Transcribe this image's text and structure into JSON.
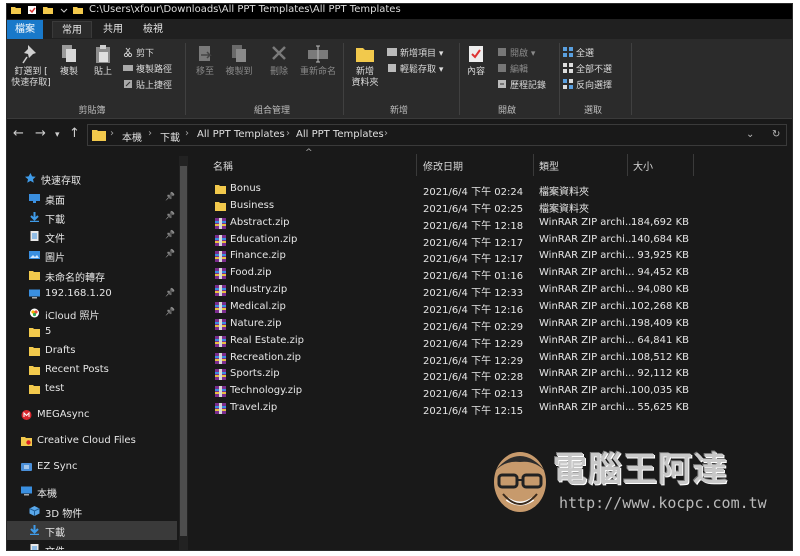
{
  "titlebar": {
    "path": "C:\\Users\\xfour\\Downloads\\All PPT Templates\\All PPT Templates"
  },
  "tabs": [
    {
      "label": "檔案"
    },
    {
      "label": "常用"
    },
    {
      "label": "共用"
    },
    {
      "label": "檢視"
    }
  ],
  "ribbon": {
    "pin_label_1": "釘選到 [",
    "pin_label_2": "快速存取]",
    "copy": "複製",
    "paste": "貼上",
    "cut": "剪下",
    "copy_path": "複製路徑",
    "paste_shortcut": "貼上捷徑",
    "clipboard_group": "剪貼簿",
    "move_to": "移至",
    "copy_to": "複製到",
    "delete": "刪除",
    "rename": "重新命名",
    "organize_group": "組合管理",
    "new_item": "新增項目",
    "easy_access": "輕鬆存取",
    "new_folder_1": "新增",
    "new_folder_2": "資料夾",
    "new_group": "新增",
    "properties": "內容",
    "open": "開啟",
    "edit": "編輯",
    "history": "歷程記錄",
    "open_group": "開啟",
    "select_all": "全選",
    "select_none": "全部不選",
    "invert_selection": "反向選擇",
    "select_group": "選取"
  },
  "address": {
    "crumbs": [
      "本機",
      "下載",
      "All PPT Templates",
      "All PPT Templates"
    ]
  },
  "sidebar": {
    "items": [
      {
        "label": "快速存取",
        "icon": "star-icon"
      },
      {
        "label": "桌面",
        "icon": "desktop-icon"
      },
      {
        "label": "下載",
        "icon": "download-icon"
      },
      {
        "label": "文件",
        "icon": "document-icon"
      },
      {
        "label": "圖片",
        "icon": "picture-icon"
      },
      {
        "label": "未命名的轉存",
        "icon": "folder-icon"
      },
      {
        "label": "192.168.1.20",
        "icon": "monitor-icon"
      },
      {
        "label": "iCloud 照片",
        "icon": "icloud-photos-icon"
      },
      {
        "label": "5",
        "icon": "folder-icon"
      },
      {
        "label": "Drafts",
        "icon": "folder-icon"
      },
      {
        "label": "Recent Posts",
        "icon": "folder-icon"
      },
      {
        "label": "test",
        "icon": "folder-icon"
      },
      {
        "label": "MEGAsync",
        "icon": "megasync-icon"
      },
      {
        "label": "Creative Cloud Files",
        "icon": "creative-cloud-icon"
      },
      {
        "label": "EZ Sync",
        "icon": "ezsync-icon"
      },
      {
        "label": "本機",
        "icon": "pc-icon"
      },
      {
        "label": "3D 物件",
        "icon": "cube-icon"
      },
      {
        "label": "下載",
        "icon": "download-icon"
      },
      {
        "label": "文件",
        "icon": "document-icon"
      }
    ]
  },
  "list": {
    "headers": {
      "name": "名稱",
      "date": "修改日期",
      "type": "類型",
      "size": "大小"
    },
    "rows": [
      {
        "name": "Bonus",
        "date": "2021/6/4 下午 02:24",
        "type": "檔案資料夾",
        "size": "",
        "kind": "folder"
      },
      {
        "name": "Business",
        "date": "2021/6/4 下午 02:25",
        "type": "檔案資料夾",
        "size": "",
        "kind": "folder"
      },
      {
        "name": "Abstract.zip",
        "date": "2021/6/4 下午 12:18",
        "type": "WinRAR ZIP archi...",
        "size": "184,692 KB",
        "kind": "zip"
      },
      {
        "name": "Education.zip",
        "date": "2021/6/4 下午 12:17",
        "type": "WinRAR ZIP archi...",
        "size": "140,684 KB",
        "kind": "zip"
      },
      {
        "name": "Finance.zip",
        "date": "2021/6/4 下午 12:17",
        "type": "WinRAR ZIP archi...",
        "size": "93,925 KB",
        "kind": "zip"
      },
      {
        "name": "Food.zip",
        "date": "2021/6/4 下午 01:16",
        "type": "WinRAR ZIP archi...",
        "size": "94,452 KB",
        "kind": "zip"
      },
      {
        "name": "Industry.zip",
        "date": "2021/6/4 下午 12:33",
        "type": "WinRAR ZIP archi...",
        "size": "94,080 KB",
        "kind": "zip"
      },
      {
        "name": "Medical.zip",
        "date": "2021/6/4 下午 12:16",
        "type": "WinRAR ZIP archi...",
        "size": "102,268 KB",
        "kind": "zip"
      },
      {
        "name": "Nature.zip",
        "date": "2021/6/4 下午 02:29",
        "type": "WinRAR ZIP archi...",
        "size": "198,409 KB",
        "kind": "zip"
      },
      {
        "name": "Real Estate.zip",
        "date": "2021/6/4 下午 12:29",
        "type": "WinRAR ZIP archi...",
        "size": "64,841 KB",
        "kind": "zip"
      },
      {
        "name": "Recreation.zip",
        "date": "2021/6/4 下午 12:29",
        "type": "WinRAR ZIP archi...",
        "size": "108,512 KB",
        "kind": "zip"
      },
      {
        "name": "Sports.zip",
        "date": "2021/6/4 下午 02:28",
        "type": "WinRAR ZIP archi...",
        "size": "92,112 KB",
        "kind": "zip"
      },
      {
        "name": "Technology.zip",
        "date": "2021/6/4 下午 02:13",
        "type": "WinRAR ZIP archi...",
        "size": "100,035 KB",
        "kind": "zip"
      },
      {
        "name": "Travel.zip",
        "date": "2021/6/4 下午 12:15",
        "type": "WinRAR ZIP archi...",
        "size": "55,625 KB",
        "kind": "zip"
      }
    ]
  },
  "watermark": {
    "title": "電腦王阿達",
    "url": "http://www.kocpc.com.tw"
  },
  "colors": {
    "accent": "#1979ca",
    "folder": "#f2c94c",
    "background": "#191919"
  }
}
